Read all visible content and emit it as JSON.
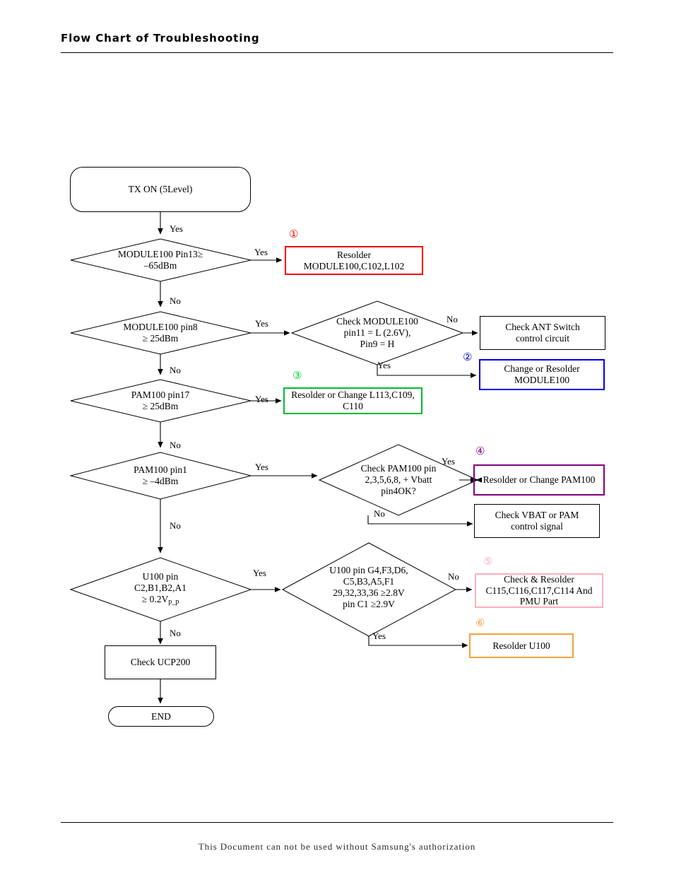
{
  "header": {
    "title": "Flow Chart of Troubleshooting"
  },
  "footer": {
    "notice": "This Document can not be used without Samsung's authorization"
  },
  "colors": {
    "default_outline": "#000000",
    "marker1": "#ff0000",
    "marker2": "#0000cc",
    "marker3": "#00cc33",
    "marker4": "#800080",
    "marker5": "#ffaec0",
    "marker6": "#f2a33c",
    "box1_border": "#ff0000",
    "box2_border": "#0000ee",
    "box3_border": "#00bb33",
    "box4_border": "#800080",
    "box5_border": "#ffaec0",
    "box6_border": "#f2a33c"
  },
  "flow": {
    "start": {
      "label": "TX ON (5Level)"
    },
    "end": {
      "label": "END"
    },
    "decisions": {
      "d1": {
        "line1": "MODULE100 Pin13≥",
        "line2": "–65dBm"
      },
      "d2": {
        "line1": "MODULE100 pin8",
        "line2": "≥ 25dBm"
      },
      "d2b": {
        "line1": "Check MODULE100",
        "line2": "pin11 = L (2.6V),",
        "line3": "Pin9 = H"
      },
      "d3": {
        "line1": "PAM100 pin17",
        "line2": "≥ 25dBm"
      },
      "d4": {
        "line1": "PAM100 pin1",
        "line2": "≥ –4dBm"
      },
      "d4b": {
        "line1": "Check PAM100 pin",
        "line2": "2,3,5,6,8, + Vbatt",
        "line3": "pin4OK?"
      },
      "d5": {
        "line1": "U100 pin",
        "line2": "C2,B1,B2,A1",
        "line3a": "≥ 0.2V",
        "line3b": "p_p"
      },
      "d5b": {
        "line1": "U100 pin G4,F3,D6,",
        "line2": "C5,B3,A5,F1",
        "line3": "29,32,33,36 ≥2.8V",
        "line4": "pin C1 ≥2.9V"
      }
    },
    "actions": {
      "a1": {
        "line1": "Resolder",
        "line2": "MODULE100,C102,L102",
        "marker": "①"
      },
      "a2": {
        "line1": "Change or Resolder",
        "line2": "MODULE100",
        "marker": "②"
      },
      "a3": {
        "line1": "Resolder or Change L113,C109,",
        "line2": "C110",
        "marker": "③"
      },
      "a4": {
        "line1": "Resolder or Change PAM100",
        "marker": "④"
      },
      "a5": {
        "line1": "Check & Resolder",
        "line2": "C115,C116,C117,C114 And",
        "line3": "PMU Part",
        "marker": "⑤"
      },
      "a6": {
        "line1": "Resolder U100",
        "marker": "⑥"
      },
      "ant": {
        "line1": "Check ANT Switch",
        "line2": "control circuit"
      },
      "vbat": {
        "line1": "Check VBAT or PAM",
        "line2": "control signal"
      },
      "ucp": {
        "line1": "Check UCP200"
      }
    },
    "edge_labels": {
      "start_yes": "Yes",
      "d1_yes": "Yes",
      "d1_no": "No",
      "d2_yes": "Yes",
      "d2_no": "No",
      "d2b_no": "No",
      "d2b_yes": "Yes",
      "d3_yes": "Yes",
      "d3_no": "No",
      "d4_yes": "Yes",
      "d4_no": "No",
      "d4b_yes": "Yes",
      "d4b_no": "No",
      "d5_yes": "Yes",
      "d5_no": "No",
      "d5b_no": "No",
      "d5b_yes": "Yes"
    }
  }
}
